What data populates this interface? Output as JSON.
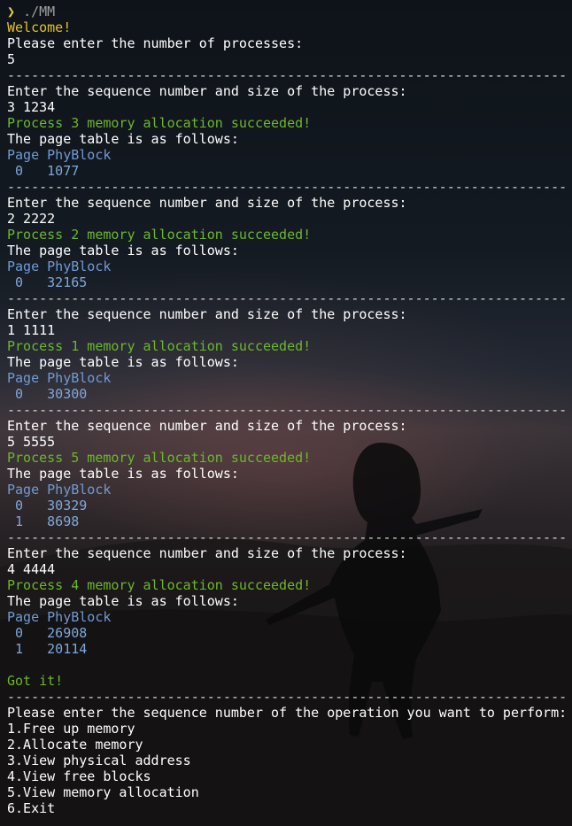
{
  "prompt": {
    "symbol": "❯",
    "command": "./MM"
  },
  "welcome": "Welcome!",
  "ask_count": "Please enter the number of processes:",
  "count_input": "5",
  "separator": "----------------------------------------------------------------------",
  "blocks": [
    {
      "prompt": "Enter the sequence number and size of the process:",
      "input": "3 1234",
      "success": "Process 3 memory allocation succeeded!",
      "table_title": "The page table is as follows:",
      "table_header": "Page PhyBlock",
      "rows": [
        " 0   1077"
      ]
    },
    {
      "prompt": "Enter the sequence number and size of the process:",
      "input": "2 2222",
      "success": "Process 2 memory allocation succeeded!",
      "table_title": "The page table is as follows:",
      "table_header": "Page PhyBlock",
      "rows": [
        " 0   32165"
      ]
    },
    {
      "prompt": "Enter the sequence number and size of the process:",
      "input": "1 1111",
      "success": "Process 1 memory allocation succeeded!",
      "table_title": "The page table is as follows:",
      "table_header": "Page PhyBlock",
      "rows": [
        " 0   30300"
      ]
    },
    {
      "prompt": "Enter the sequence number and size of the process:",
      "input": "5 5555",
      "success": "Process 5 memory allocation succeeded!",
      "table_title": "The page table is as follows:",
      "table_header": "Page PhyBlock",
      "rows": [
        " 0   30329",
        " 1   8698"
      ]
    },
    {
      "prompt": "Enter the sequence number and size of the process:",
      "input": "4 4444",
      "success": "Process 4 memory allocation succeeded!",
      "table_title": "The page table is as follows:",
      "table_header": "Page PhyBlock",
      "rows": [
        " 0   26908",
        " 1   20114"
      ]
    }
  ],
  "got_it": "Got it!",
  "menu_prompt": "Please enter the sequence number of the operation you want to perform:",
  "menu_items": [
    "1.Free up memory",
    "2.Allocate memory",
    "3.View physical address",
    "4.View free blocks",
    "5.View memory allocation",
    "6.Exit"
  ],
  "colors": {
    "prompt": "#e6d04a",
    "welcome": "#e6c027",
    "success": "#6ab92a",
    "table": "#6e9bd6",
    "text": "#ffffff"
  }
}
